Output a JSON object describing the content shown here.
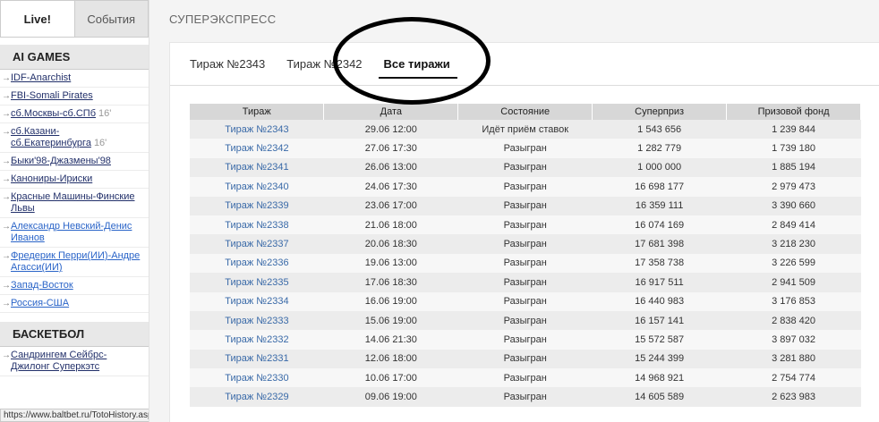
{
  "sidebar": {
    "tabs": [
      "Live!",
      "События"
    ],
    "sections": [
      {
        "title": "AI GAMES",
        "items": [
          {
            "label": "IDF-Anarchist",
            "minute": ""
          },
          {
            "label": "FBI-Somali Pirates",
            "minute": ""
          },
          {
            "label": "сб.Москвы-сб.СПб",
            "minute": "16'"
          },
          {
            "label": "сб.Казани-сб.Екатеринбурга",
            "minute": "16'"
          },
          {
            "label": "Быки'98-Джазмены'98",
            "minute": ""
          },
          {
            "label": "Канониры-Ириски",
            "minute": ""
          },
          {
            "label": "Красные Машины-Финские Львы",
            "minute": ""
          },
          {
            "label": "Александр Невский-Денис Иванов",
            "minute": ""
          },
          {
            "label": "Фредерик Перри(ИИ)-Андре Агасси(ИИ)",
            "minute": ""
          },
          {
            "label": "Запад-Восток",
            "minute": ""
          },
          {
            "label": "Россия-США",
            "minute": ""
          }
        ]
      },
      {
        "title": "БАСКЕТБОЛ",
        "items": [
          {
            "label": "Сандрингем Сейбрс-Джилонг Суперкэтс",
            "minute": ""
          }
        ]
      }
    ],
    "status_url": "https://www.baltbet.ru/TotoHistory.aspx?id=4"
  },
  "main": {
    "title": "СУПЕРЭКСПРЕСС",
    "tabs": [
      "Тираж №2343",
      "Тираж №2342",
      "Все тиражи"
    ],
    "table": {
      "headers": [
        "Тираж",
        "Дата",
        "Состояние",
        "Суперприз",
        "Призовой фонд"
      ],
      "rows": [
        [
          "Тираж №2343",
          "29.06 12:00",
          "Идёт приём ставок",
          "1 543 656",
          "1 239 844"
        ],
        [
          "Тираж №2342",
          "27.06 17:30",
          "Разыгран",
          "1 282 779",
          "1 739 180"
        ],
        [
          "Тираж №2341",
          "26.06 13:00",
          "Разыгран",
          "1 000 000",
          "1 885 194"
        ],
        [
          "Тираж №2340",
          "24.06 17:30",
          "Разыгран",
          "16 698 177",
          "2 979 473"
        ],
        [
          "Тираж №2339",
          "23.06 17:00",
          "Разыгран",
          "16 359 111",
          "3 390 660"
        ],
        [
          "Тираж №2338",
          "21.06 18:00",
          "Разыгран",
          "16 074 169",
          "2 849 414"
        ],
        [
          "Тираж №2337",
          "20.06 18:30",
          "Разыгран",
          "17 681 398",
          "3 218 230"
        ],
        [
          "Тираж №2336",
          "19.06 13:00",
          "Разыгран",
          "17 358 738",
          "3 226 599"
        ],
        [
          "Тираж №2335",
          "17.06 18:30",
          "Разыгран",
          "16 917 511",
          "2 941 509"
        ],
        [
          "Тираж №2334",
          "16.06 19:00",
          "Разыгран",
          "16 440 983",
          "3 176 853"
        ],
        [
          "Тираж №2333",
          "15.06 19:00",
          "Разыгран",
          "16 157 141",
          "2 838 420"
        ],
        [
          "Тираж №2332",
          "14.06 21:30",
          "Разыгран",
          "15 572 587",
          "3 897 032"
        ],
        [
          "Тираж №2331",
          "12.06 18:00",
          "Разыгран",
          "15 244 399",
          "3 281 880"
        ],
        [
          "Тираж №2330",
          "10.06 17:00",
          "Разыгран",
          "14 968 921",
          "2 754 774"
        ],
        [
          "Тираж №2329",
          "09.06 19:00",
          "Разыгран",
          "14 605 589",
          "2 623 983"
        ]
      ]
    }
  },
  "colors": {
    "link": "#3a6aa8",
    "header_bg": "#d7d7d7",
    "annotation": "#000000"
  }
}
